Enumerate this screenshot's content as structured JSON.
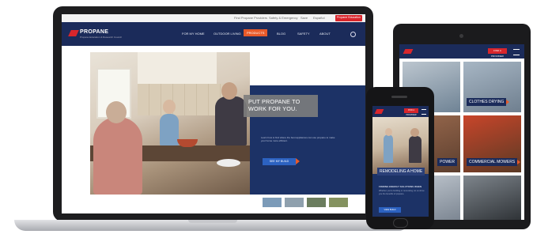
{
  "laptop": {
    "util_links": [
      "Find Propane Providers",
      "Safety & Emergency",
      "Save",
      "Español",
      "Propane Education"
    ],
    "nav": {
      "logo_text": "PROPANE",
      "logo_sub": "Propane Education & Research Council",
      "items": [
        "FOR MY HOME",
        "OUTDOOR LIVING",
        "PRODUCTS",
        "BLOG",
        "SAFETY",
        "ABOUT"
      ]
    },
    "hero": {
      "headline": "PUT PROPANE TO WORK FOR YOU.",
      "copy": "Learn how to find where the best appliances can use propane to make your home more efficient.",
      "cta_label": "SEE MY BUILD"
    },
    "thumb_colors": [
      "#7c9bb8",
      "#8fa0ad",
      "#6b7d5e",
      "#84925f"
    ]
  },
  "tablet": {
    "nav_button": "FIND A PROVIDER",
    "tiles": [
      {
        "label": "",
        "colors": [
          "#bcc6cf",
          "#6f8395"
        ]
      },
      {
        "label": "CLOTHES DRYING",
        "colors": [
          "#a7b6c4",
          "#6f7f8f"
        ]
      },
      {
        "label": "POWER",
        "colors": [
          "#9a6a4e",
          "#5c3e2e"
        ]
      },
      {
        "label": "COMMERCIAL MOWERS",
        "colors": [
          "#c8452a",
          "#5b3a25"
        ]
      },
      {
        "label": "",
        "colors": [
          "#c3cad2",
          "#7c8692"
        ]
      },
      {
        "label": "",
        "colors": [
          "#7e858c",
          "#2f3337"
        ]
      }
    ]
  },
  "phone": {
    "nav_button": "FIND A PROVIDER",
    "caption": "REMODELING A HOME",
    "subhead": "FINDING ENERGY SOLUTIONS WHEN",
    "copy": "Whether you're building or renovating, let us show you the benefits of propane.",
    "cta_label": "VIEW BUILD"
  }
}
